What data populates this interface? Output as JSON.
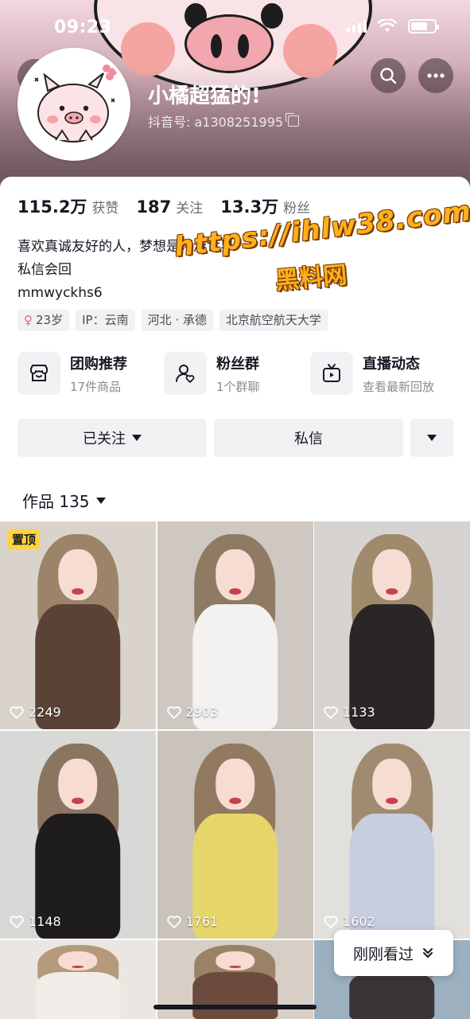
{
  "status_bar": {
    "time": "09:23"
  },
  "profile": {
    "nickname": "小橘超猛的!",
    "douyin_id": "抖音号: a1308251995"
  },
  "stats": [
    {
      "value": "115.2万",
      "label": "获赞"
    },
    {
      "value": "187",
      "label": "关注"
    },
    {
      "value": "13.3万",
      "label": "粉丝"
    }
  ],
  "bio": {
    "line1": "喜欢真诚友好的人，梦想是环游世界",
    "line2": "私信会回",
    "line3": "mmwyckhs6"
  },
  "watermark": {
    "url": "https://ihlw38.com",
    "site": "黑料网"
  },
  "tags": [
    {
      "label": "23岁",
      "icon": "female-icon"
    },
    {
      "label": "IP：云南"
    },
    {
      "label": "河北 · 承德"
    },
    {
      "label": "北京航空航天大学"
    }
  ],
  "features": [
    {
      "title": "团购推荐",
      "subtitle": "17件商品",
      "icon": "shop-icon"
    },
    {
      "title": "粉丝群",
      "subtitle": "1个群聊",
      "icon": "fan-group-icon"
    },
    {
      "title": "直播动态",
      "subtitle": "查看最新回放",
      "icon": "tv-icon"
    }
  ],
  "actions": {
    "follow": "已关注",
    "message": "私信"
  },
  "works": {
    "label": "作品 135"
  },
  "videos": [
    {
      "likes": "2249",
      "pinned": "置顶",
      "bg": "#d9d3cc",
      "hair": "#9c8468",
      "outfit": "#5a4236"
    },
    {
      "likes": "2903",
      "bg": "#cfc8c2",
      "hair": "#8f7b63",
      "outfit": "#f4f2f0"
    },
    {
      "likes": "1133",
      "bg": "#d6d3d0",
      "hair": "#a08a6c",
      "outfit": "#2a2628"
    },
    {
      "likes": "1148",
      "bg": "#d8d8d6",
      "hair": "#8a7560",
      "outfit": "#1f1c1e"
    },
    {
      "likes": "1761",
      "bg": "#c9c3bb",
      "hair": "#917a60",
      "outfit": "#e6d66a"
    },
    {
      "likes": "1602",
      "bg": "#e2e0dd",
      "hair": "#a18b70",
      "outfit": "#c7cee0"
    },
    {
      "likes": "",
      "bg": "#ebe6e2",
      "hair": "#b49a7a",
      "outfit": "#f0ece8"
    },
    {
      "likes": "",
      "bg": "#d7cec6",
      "hair": "#9a8266",
      "outfit": "#6b4b3e"
    },
    {
      "likes": "",
      "bg": "#9cb0c0",
      "hair": "#a58e72",
      "outfit": "#3a3438"
    }
  ],
  "floating": {
    "recent": "刚刚看过"
  }
}
